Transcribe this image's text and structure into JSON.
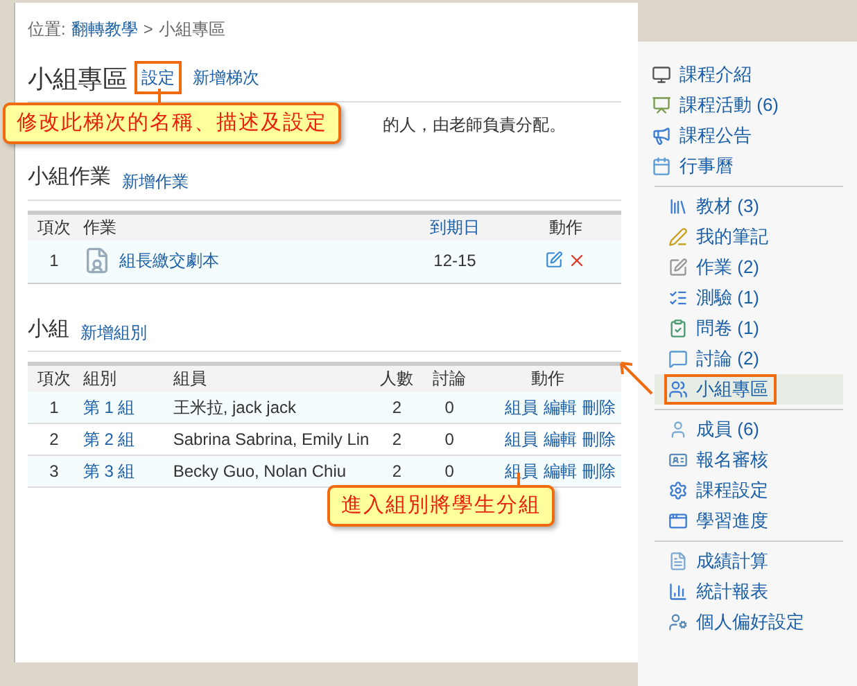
{
  "breadcrumb": {
    "prefix": "位置:",
    "link": "翻轉教學",
    "separator": ">",
    "current": "小組專區"
  },
  "page_title": "小組專區",
  "title_links": [
    {
      "label": "設定",
      "highlighted": true
    },
    {
      "label": "新增梯次",
      "highlighted": false
    }
  ],
  "description": "的人，由老師負責分配。",
  "callouts": [
    {
      "text": "修改此梯次的名稱、描述及設定"
    },
    {
      "text": "進入組別將學生分組"
    }
  ],
  "assignments": {
    "title": "小組作業",
    "add_link": "新增作業",
    "columns": [
      "項次",
      "作業",
      "到期日",
      "動作"
    ],
    "rows": [
      {
        "index": "1",
        "name": "組長繳交劇本",
        "due": "12-15"
      }
    ]
  },
  "groups": {
    "title": "小組",
    "add_link": "新增組別",
    "columns": [
      "項次",
      "組別",
      "組員",
      "人數",
      "討論",
      "動作"
    ],
    "rows": [
      {
        "index": "1",
        "group": "第 1 組",
        "members": "王米拉, jack jack",
        "count": "2",
        "discussions": "0",
        "actions": [
          "組員",
          "編輯",
          "刪除"
        ]
      },
      {
        "index": "2",
        "group": "第 2 組",
        "members": "Sabrina Sabrina, Emily Lin",
        "count": "2",
        "discussions": "0",
        "actions": [
          "組員",
          "編輯",
          "刪除"
        ]
      },
      {
        "index": "3",
        "group": "第 3 組",
        "members": "Becky Guo, Nolan Chiu",
        "count": "2",
        "discussions": "0",
        "actions": [
          "組員",
          "編輯",
          "刪除"
        ]
      }
    ]
  },
  "sidebar": {
    "sections": [
      {
        "items": [
          {
            "label": "課程介紹",
            "selected": false
          },
          {
            "label": "課程活動 (6)",
            "selected": false
          },
          {
            "label": "課程公告",
            "selected": false
          },
          {
            "label": "行事曆",
            "selected": false
          }
        ]
      },
      {
        "items": [
          {
            "label": "教材 (3)",
            "selected": false
          },
          {
            "label": "我的筆記",
            "selected": false
          },
          {
            "label": "作業 (2)",
            "selected": false
          },
          {
            "label": "測驗 (1)",
            "selected": false
          },
          {
            "label": "問卷 (1)",
            "selected": false
          },
          {
            "label": "討論 (2)",
            "selected": false
          },
          {
            "label": "小組專區",
            "selected": true
          }
        ]
      },
      {
        "items": [
          {
            "label": "成員 (6)",
            "selected": false
          },
          {
            "label": "報名審核",
            "selected": false
          },
          {
            "label": "課程設定",
            "selected": false
          },
          {
            "label": "學習進度",
            "selected": false
          }
        ]
      },
      {
        "items": [
          {
            "label": "成績計算",
            "selected": false
          },
          {
            "label": "統計報表",
            "selected": false
          },
          {
            "label": "個人偏好設定",
            "selected": false
          }
        ]
      }
    ]
  }
}
